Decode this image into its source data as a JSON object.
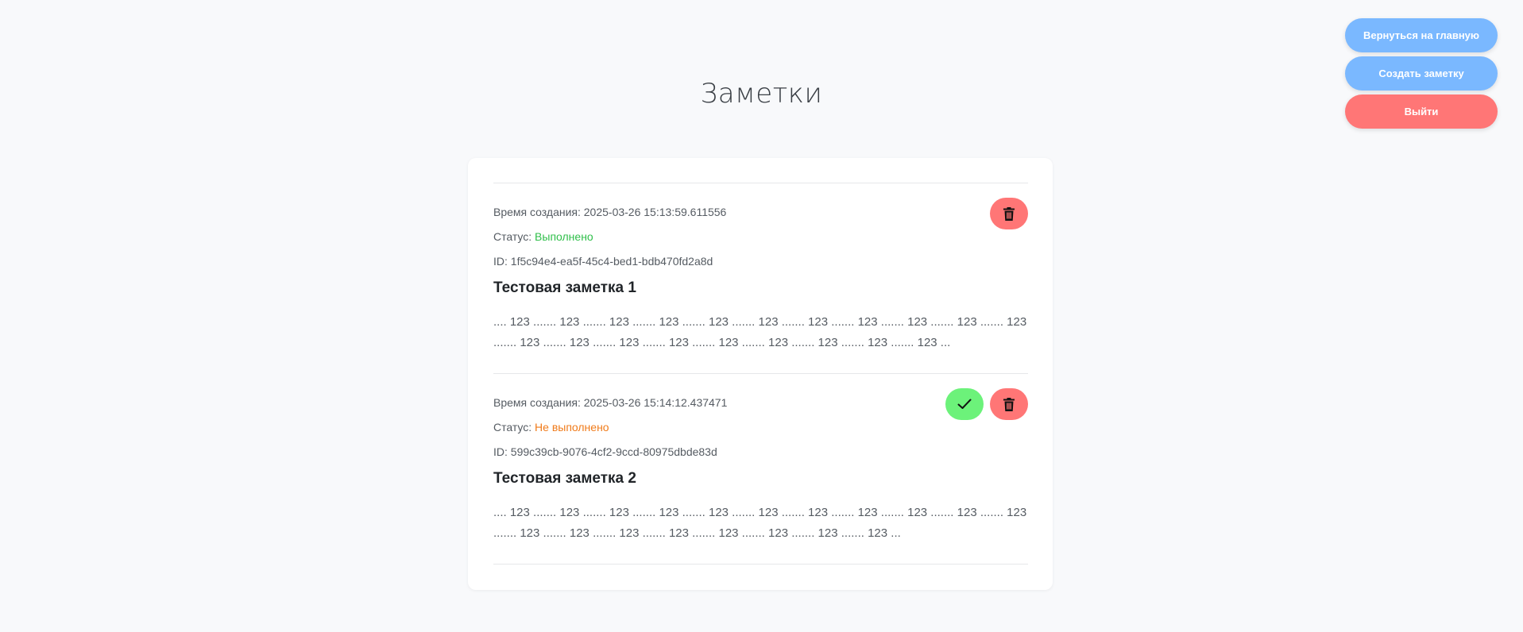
{
  "header": {
    "title": "Заметки"
  },
  "actions": {
    "home_label": "Вернуться на главную",
    "create_label": "Создать заметку",
    "logout_label": "Выйти"
  },
  "notes": [
    {
      "created": "Время создания: 2025-03-26 15:13:59.611556",
      "status_prefix": "Статус:",
      "status_value": "Выполнено",
      "id": "ID: 1f5c94e4-ea5f-45c4-bed1-bdb470fd2a8d",
      "title": "Тестовая заметка 1",
      "body": ".... 123 ....... 123 ....... 123 ....... 123 ....... 123 ....... 123 ....... 123 ....... 123 ....... 123 ....... 123 ....... 123 ....... 123 ....... 123 ....... 123 ....... 123 ....... 123 ....... 123 ....... 123 ....... 123 ....... 123 ..."
    },
    {
      "created": "Время создания: 2025-03-26 15:14:12.437471",
      "status_prefix": "Статус:",
      "status_value": "Не выполнено",
      "id": "ID: 599c39cb-9076-4cf2-9ccd-80975dbde83d",
      "title": "Тестовая заметка 2",
      "body": ".... 123 ....... 123 ....... 123 ....... 123 ....... 123 ....... 123 ....... 123 ....... 123 ....... 123 ....... 123 ....... 123 ....... 123 ....... 123 ....... 123 ....... 123 ....... 123 ....... 123 ....... 123 ....... 123 ..."
    }
  ],
  "icons": {
    "delete": "trash-icon",
    "complete": "check-icon"
  },
  "colors": {
    "primary": "#7ab8ff",
    "danger": "#ff7676",
    "success": "#6cf27a",
    "status_done": "#2fbf4a",
    "status_todo": "#f07b1a"
  }
}
